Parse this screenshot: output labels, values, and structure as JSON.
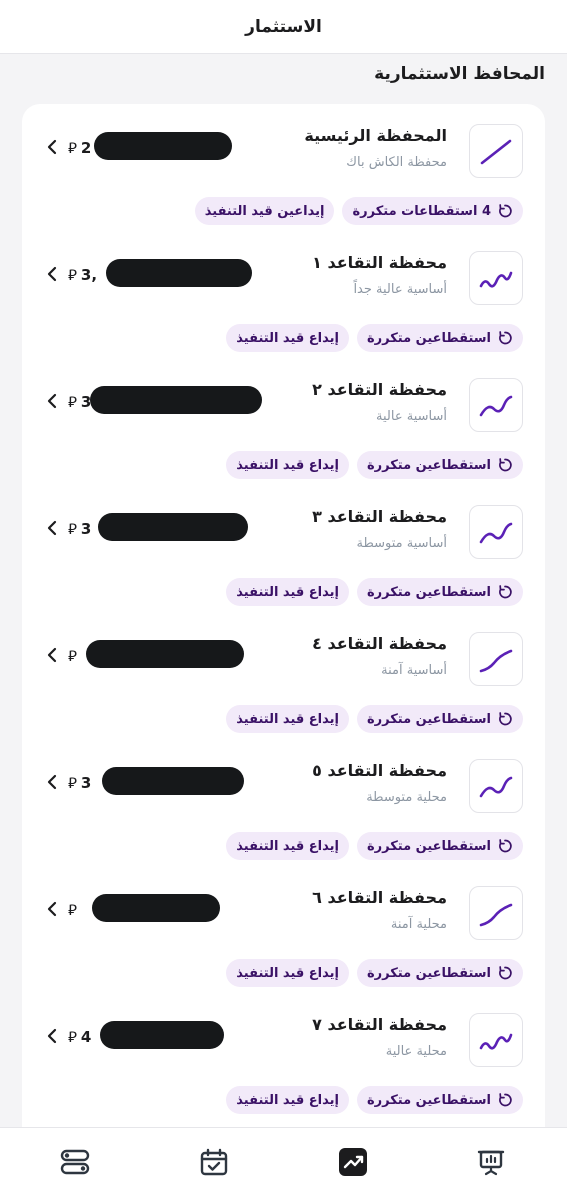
{
  "header": {
    "title": "الاستثمار"
  },
  "section": {
    "title": "المحافظ الاستثمارية"
  },
  "currency_symbol": "⃁",
  "portfolios": [
    {
      "name": "المحفظة الرئيسية",
      "subtitle": "محفظة الكاش باك",
      "amount_prefix": "2",
      "chip_recurring": "4 استقطاعات متكررة",
      "chip_deposit": "إيداعين قيد التنفيذ",
      "icon": "straight-line-chart-icon"
    },
    {
      "name": "محفظة التقاعد ١",
      "subtitle": "أساسية عالية جداً",
      "amount_prefix": "3,",
      "chip_recurring": "استقطاعين متكررة",
      "chip_deposit": "إيداع قيد التنفيذ",
      "icon": "zigzag-chart-icon"
    },
    {
      "name": "محفظة التقاعد ٢",
      "subtitle": "أساسية عالية",
      "amount_prefix": "3",
      "chip_recurring": "استقطاعين متكررة",
      "chip_deposit": "إيداع قيد التنفيذ",
      "icon": "wave-chart-icon"
    },
    {
      "name": "محفظة التقاعد ٣",
      "subtitle": "أساسية متوسطة",
      "amount_prefix": "3",
      "chip_recurring": "استقطاعين متكررة",
      "chip_deposit": "إيداع قيد التنفيذ",
      "icon": "wave-chart-icon"
    },
    {
      "name": "محفظة التقاعد ٤",
      "subtitle": "أساسية آمنة",
      "amount_prefix": "",
      "chip_recurring": "استقطاعين متكررة",
      "chip_deposit": "إيداع قيد التنفيذ",
      "icon": "smooth-curve-chart-icon"
    },
    {
      "name": "محفظة التقاعد ٥",
      "subtitle": "محلية متوسطة",
      "amount_prefix": "3",
      "chip_recurring": "استقطاعين متكررة",
      "chip_deposit": "إيداع قيد التنفيذ",
      "icon": "wave-chart-icon"
    },
    {
      "name": "محفظة التقاعد ٦",
      "subtitle": "محلية آمنة",
      "amount_prefix": "",
      "chip_recurring": "استقطاعين متكررة",
      "chip_deposit": "إيداع قيد التنفيذ",
      "icon": "smooth-curve-chart-icon"
    },
    {
      "name": "محفظة التقاعد ٧",
      "subtitle": "محلية عالية",
      "amount_prefix": "4",
      "chip_recurring": "استقطاعين متكررة",
      "chip_deposit": "إيداع قيد التنفيذ",
      "icon": "zigzag-chart-icon"
    }
  ],
  "bottom_nav": [
    {
      "icon": "presentation-chart-icon"
    },
    {
      "icon": "trending-chart-icon",
      "active": true
    },
    {
      "icon": "calendar-check-icon"
    },
    {
      "icon": "toggles-icon"
    }
  ],
  "colors": {
    "accent": "#5b21b6",
    "chip_bg": "#f2eaf9",
    "chip_text": "#3a1166",
    "subtitle": "#8d97a3"
  }
}
